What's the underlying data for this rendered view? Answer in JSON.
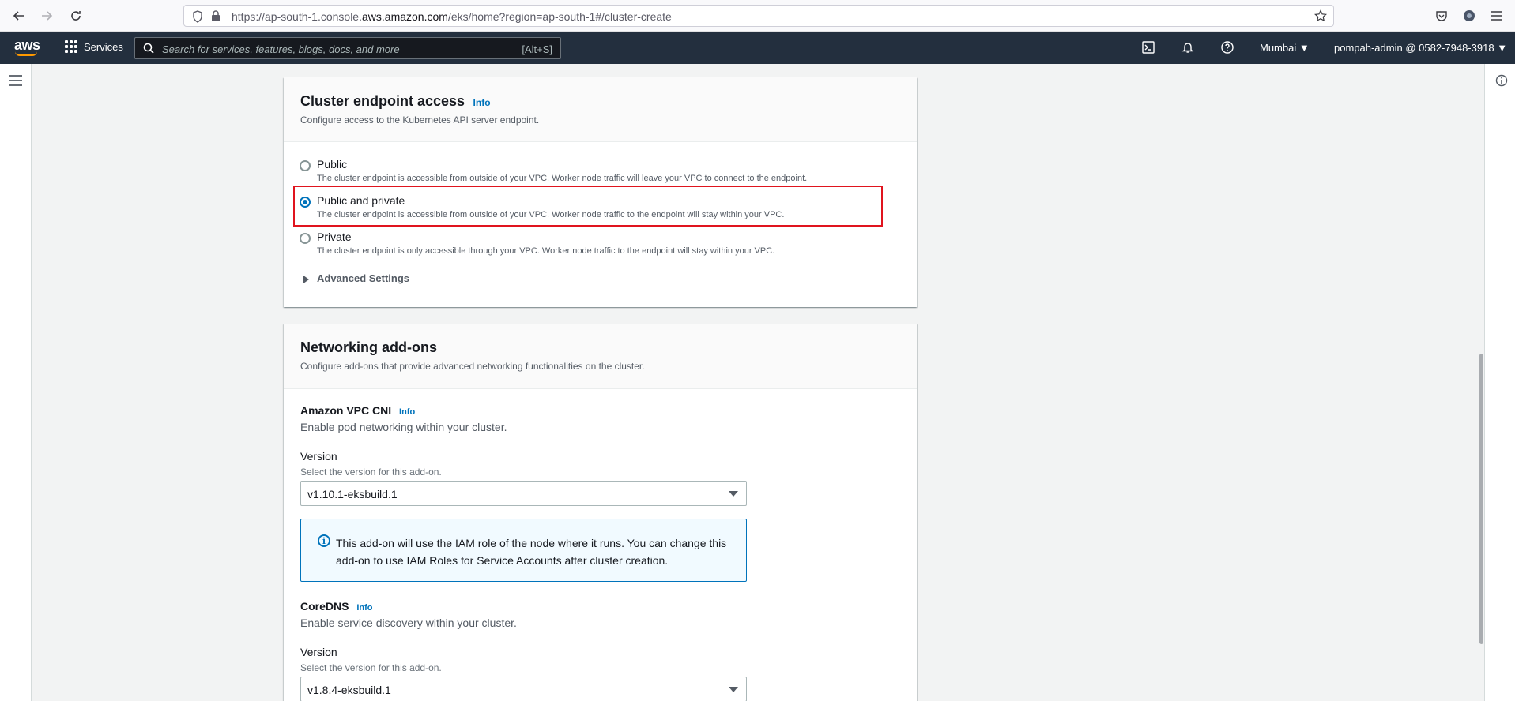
{
  "browser": {
    "url_prefix": "https://ap-south-1.console.",
    "url_domain": "aws.amazon.com",
    "url_suffix": "/eks/home?region=ap-south-1#/cluster-create"
  },
  "aws_nav": {
    "logo": "aws",
    "services_label": "Services",
    "search_placeholder": "Search for services, features, blogs, docs, and more",
    "search_shortcut": "[Alt+S]",
    "region": "Mumbai",
    "account": "pompah-admin @ 0582-7948-3918"
  },
  "endpoint_access": {
    "title": "Cluster endpoint access",
    "info": "Info",
    "description": "Configure access to the Kubernetes API server endpoint.",
    "options": [
      {
        "label": "Public",
        "description": "The cluster endpoint is accessible from outside of your VPC. Worker node traffic will leave your VPC to connect to the endpoint.",
        "checked": false
      },
      {
        "label": "Public and private",
        "description": "The cluster endpoint is accessible from outside of your VPC. Worker node traffic to the endpoint will stay within your VPC.",
        "checked": true
      },
      {
        "label": "Private",
        "description": "The cluster endpoint is only accessible through your VPC. Worker node traffic to the endpoint will stay within your VPC.",
        "checked": false
      }
    ],
    "advanced_settings": "Advanced Settings"
  },
  "networking_addons": {
    "title": "Networking add-ons",
    "description": "Configure add-ons that provide advanced networking functionalities on the cluster.",
    "vpc_cni": {
      "title": "Amazon VPC CNI",
      "info": "Info",
      "description": "Enable pod networking within your cluster.",
      "version_label": "Version",
      "version_hint": "Select the version for this add-on.",
      "version_value": "v1.10.1-eksbuild.1",
      "alert": "This add-on will use the IAM role of the node where it runs. You can change this add-on to use IAM Roles for Service Accounts after cluster creation."
    },
    "coredns": {
      "title": "CoreDNS",
      "info": "Info",
      "description": "Enable service discovery within your cluster.",
      "version_label": "Version",
      "version_hint": "Select the version for this add-on.",
      "version_value": "v1.8.4-eksbuild.1"
    }
  }
}
